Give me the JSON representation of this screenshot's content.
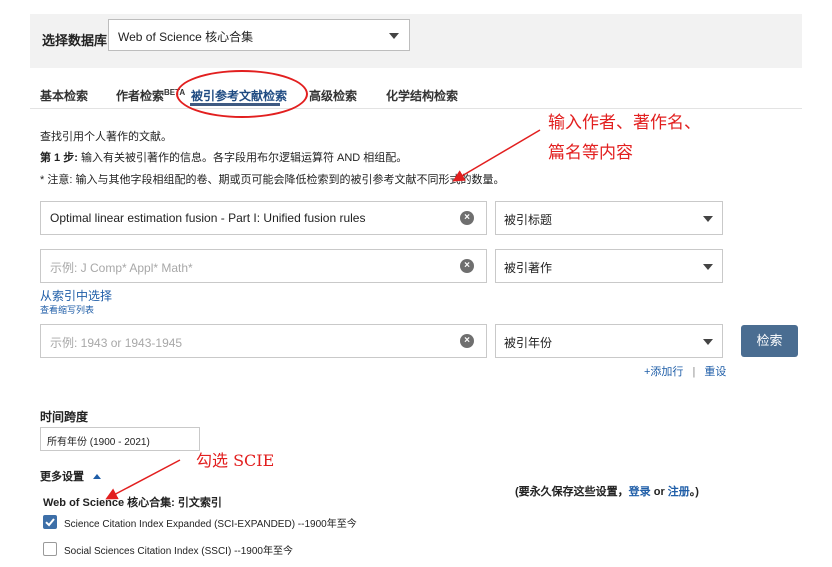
{
  "database": {
    "label": "选择数据库",
    "selected": "Web of Science 核心合集"
  },
  "tabs": [
    {
      "label": "基本检索"
    },
    {
      "label": "作者检索",
      "sup": "BETA"
    },
    {
      "label": "被引参考文献检索"
    },
    {
      "label": "高级检索"
    },
    {
      "label": "化学结构检索"
    }
  ],
  "intro": {
    "line1": "查找引用个人著作的文献。",
    "step_bold": "第 1 步:",
    "step_text": " 输入有关被引著作的信息。各字段用布尔逻辑运算符 AND 相组配。",
    "note": "* 注意: 输入与其他字段相组配的卷、期或页可能会降低检索到的被引参考文献不同形式的数量。"
  },
  "rows": [
    {
      "value": "Optimal linear estimation fusion - Part I: Unified fusion rules",
      "placeholder": "",
      "field": "被引标题"
    },
    {
      "value": "",
      "placeholder": "示例: J Comp* Appl* Math*",
      "field": "被引著作"
    },
    {
      "value": "",
      "placeholder": "示例: 1943 or 1943-1945",
      "field": "被引年份"
    }
  ],
  "index_links": {
    "select": "从索引中选择",
    "abbrev": "查看缩写列表"
  },
  "search_button": "检索",
  "row_actions": {
    "add": "+添加行",
    "sep": "|",
    "reset": "重设"
  },
  "timespan": {
    "label": "时间跨度",
    "selected": "所有年份 (1900 - 2021)"
  },
  "more_settings": "更多设置",
  "persist": {
    "prefix": "(要永久保存这些设置，",
    "login": "登录",
    "or": " or ",
    "register": "注册",
    "suffix": "。)"
  },
  "citation_index": {
    "title": "Web of Science 核心合集: 引文索引",
    "items": [
      {
        "label": "Science Citation Index Expanded (SCI-EXPANDED) --1900年至今",
        "checked": true
      },
      {
        "label": "Social Sciences Citation Index (SSCI) --1900年至今",
        "checked": false
      }
    ]
  },
  "annotations": {
    "top_line1": "输入作者、著作名、",
    "top_line2": "篇名等内容",
    "scie": "勾选 SCIE"
  },
  "colors": {
    "accent": "#4a6d91",
    "link": "#1f5ea8",
    "annotation": "#e21f1f"
  }
}
